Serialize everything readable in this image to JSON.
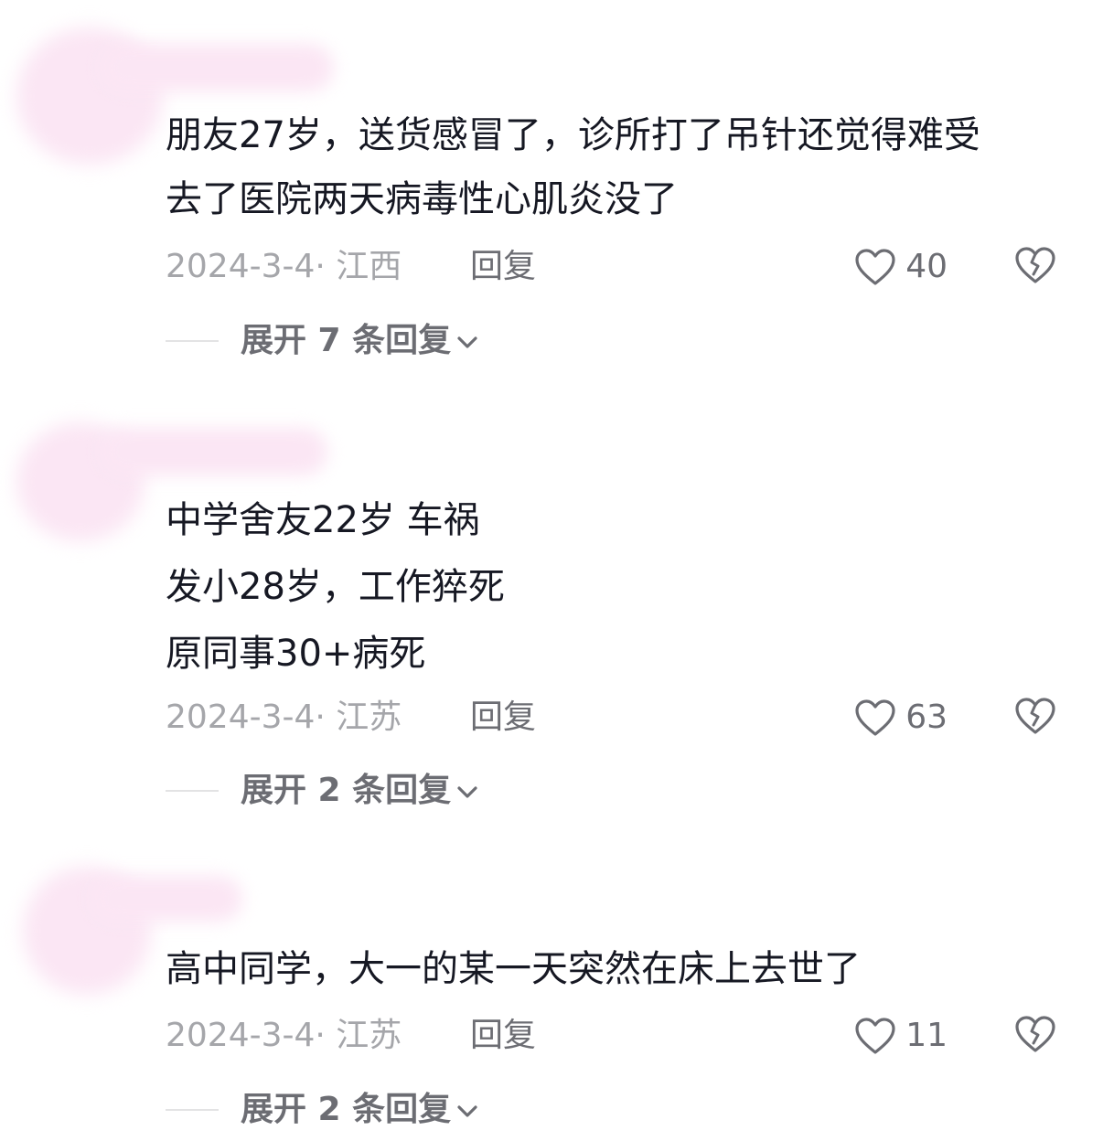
{
  "comments": [
    {
      "text_lines": [
        "朋友27岁，送货感冒了，诊所打了吊针还觉得难受",
        "去了医院两天病毒性心肌炎没了"
      ],
      "meta": "2024-3-4· 江西",
      "reply_label": "回复",
      "likes": "40",
      "expand_label": "展开 7 条回复"
    },
    {
      "text_lines": [
        "中学舍友22岁 车祸",
        "发小28岁，工作猝死",
        "原同事30+病死"
      ],
      "meta": "2024-3-4· 江苏",
      "reply_label": "回复",
      "likes": "63",
      "expand_label": "展开 2 条回复"
    },
    {
      "text_lines": [
        "高中同学，大一的某一天突然在床上去世了"
      ],
      "meta": "2024-3-4· 江苏",
      "reply_label": "回复",
      "likes": "11",
      "expand_label": "展开 2 条回复"
    }
  ],
  "colors": {
    "primary_text": "#161823",
    "secondary_text": "#a5a6aa",
    "action_text": "#6c6d73",
    "avatar_blur": "#fbe6f4"
  },
  "icons": {
    "like": "heart-outline-icon",
    "dislike": "broken-heart-icon",
    "expand": "chevron-down-icon"
  }
}
